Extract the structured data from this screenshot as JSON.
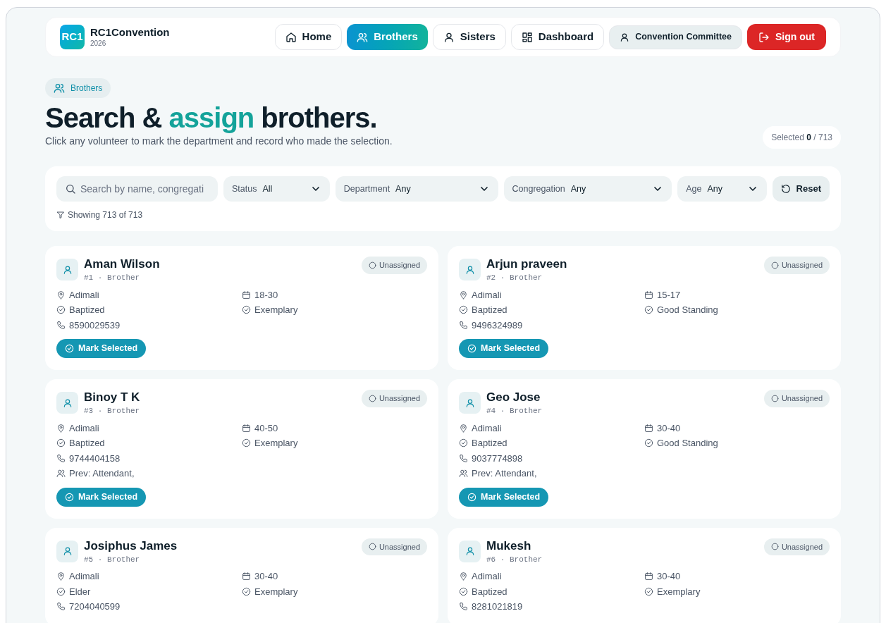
{
  "brand": {
    "logo": "RC1",
    "name": "RC1Convention",
    "year": "2026"
  },
  "nav": [
    {
      "label": "Home",
      "selected": false
    },
    {
      "label": "Brothers",
      "selected": true
    },
    {
      "label": "Sisters",
      "selected": false
    },
    {
      "label": "Dashboard",
      "selected": false
    }
  ],
  "user": {
    "label": "Convention Committee"
  },
  "signout": {
    "label": "Sign out"
  },
  "breadcrumb": {
    "label": "Brothers"
  },
  "heading": {
    "before": "Search &",
    "accent": "assign",
    "after": "brothers."
  },
  "subtitle": "Click any volunteer to mark the department and record who made the selection.",
  "selected_counter": {
    "label": "Selected",
    "count": "0",
    "total": "/ 713"
  },
  "filters": {
    "search": {
      "placeholder": "Search by name, congregati"
    },
    "selects": [
      {
        "label": "Status",
        "value": "All"
      },
      {
        "label": "Department",
        "value": "Any"
      },
      {
        "label": "Congregation",
        "value": "Any"
      },
      {
        "label": "Age",
        "value": "Any"
      }
    ],
    "reset": "Reset",
    "showing": "Showing 713 of 713"
  },
  "cards": [
    {
      "name": "Aman Wilson",
      "meta": "#1 · Brother",
      "status": "Unassigned",
      "location": "Adimali",
      "baptism": "Baptized",
      "phone": "8590029539",
      "age": "18-30",
      "standing": "Exemplary",
      "action": "Mark Selected"
    },
    {
      "name": "Arjun praveen",
      "meta": "#2 · Brother",
      "status": "Unassigned",
      "location": "Adimali",
      "baptism": "Baptized",
      "phone": "9496324989",
      "age": "15-17",
      "standing": "Good Standing",
      "action": "Mark Selected"
    },
    {
      "name": "Binoy T K",
      "meta": "#3 · Brother",
      "status": "Unassigned",
      "location": "Adimali",
      "baptism": "Baptized",
      "phone": "9744404158",
      "previous": "Prev: Attendant,",
      "age": "40-50",
      "standing": "Exemplary",
      "action": "Mark Selected"
    },
    {
      "name": "Geo Jose",
      "meta": "#4 · Brother",
      "status": "Unassigned",
      "location": "Adimali",
      "baptism": "Baptized",
      "phone": "9037774898",
      "previous": "Prev: Attendant,",
      "age": "30-40",
      "standing": "Good Standing",
      "action": "Mark Selected"
    },
    {
      "name": "Josiphus James",
      "meta": "#5 · Brother",
      "status": "Unassigned",
      "location": "Adimali",
      "baptism": "Elder",
      "phone": "7204040599",
      "age": "30-40",
      "standing": "Exemplary"
    },
    {
      "name": "Mukesh",
      "meta": "#6 · Brother",
      "status": "Unassigned",
      "location": "Adimali",
      "baptism": "Baptized",
      "phone": "8281021819",
      "age": "30-40",
      "standing": "Exemplary"
    }
  ]
}
